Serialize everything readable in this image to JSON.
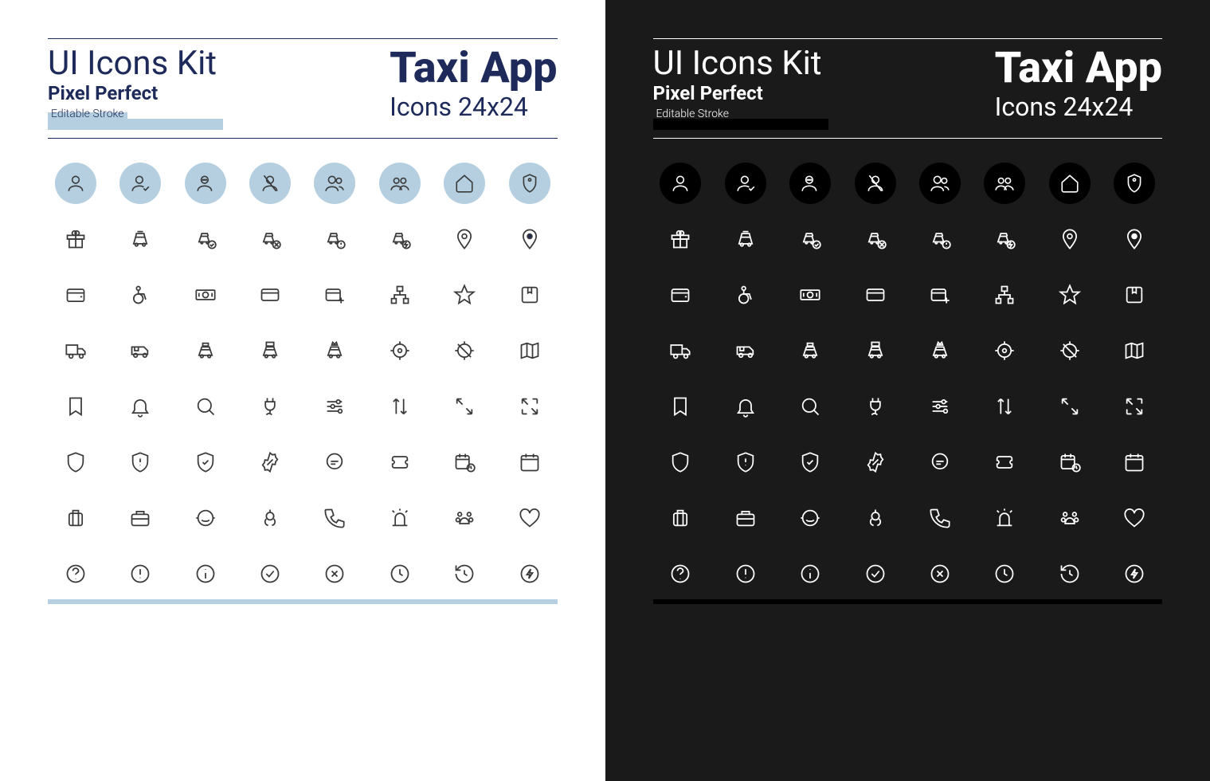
{
  "header": {
    "kit_title": "UI Icons Kit",
    "pixel_perfect": "Pixel Perfect",
    "editable_stroke": "Editable Stroke",
    "app_title": "Taxi App",
    "icons_size": "Icons 24x24"
  },
  "icons": {
    "circles": [
      "user",
      "user-check",
      "user-minus",
      "user-block",
      "users",
      "group",
      "home",
      "tag"
    ],
    "rows": [
      [
        "gift",
        "taxi",
        "taxi-check",
        "taxi-cancel",
        "taxi-alert",
        "taxi-charge",
        "pin",
        "pin-filled"
      ],
      [
        "wallet",
        "wheelchair",
        "cash",
        "card",
        "card-add",
        "sitemap",
        "star",
        "package"
      ],
      [
        "truck",
        "van",
        "car-luggage",
        "car-roof",
        "car-crown",
        "target",
        "target-off",
        "map"
      ],
      [
        "bookmark",
        "bell",
        "search",
        "plug-eco",
        "sliders",
        "sort",
        "collapse",
        "expand"
      ],
      [
        "shield",
        "shield-alert",
        "shield-check",
        "discount",
        "chat",
        "ticket",
        "calendar-clock",
        "calendar"
      ],
      [
        "suitcase",
        "briefcase",
        "support",
        "pacifier",
        "phone",
        "siren",
        "paw",
        "heart"
      ],
      [
        "help",
        "alert",
        "info",
        "check-circle",
        "x-circle",
        "clock",
        "history",
        "bolt-circle"
      ]
    ]
  }
}
